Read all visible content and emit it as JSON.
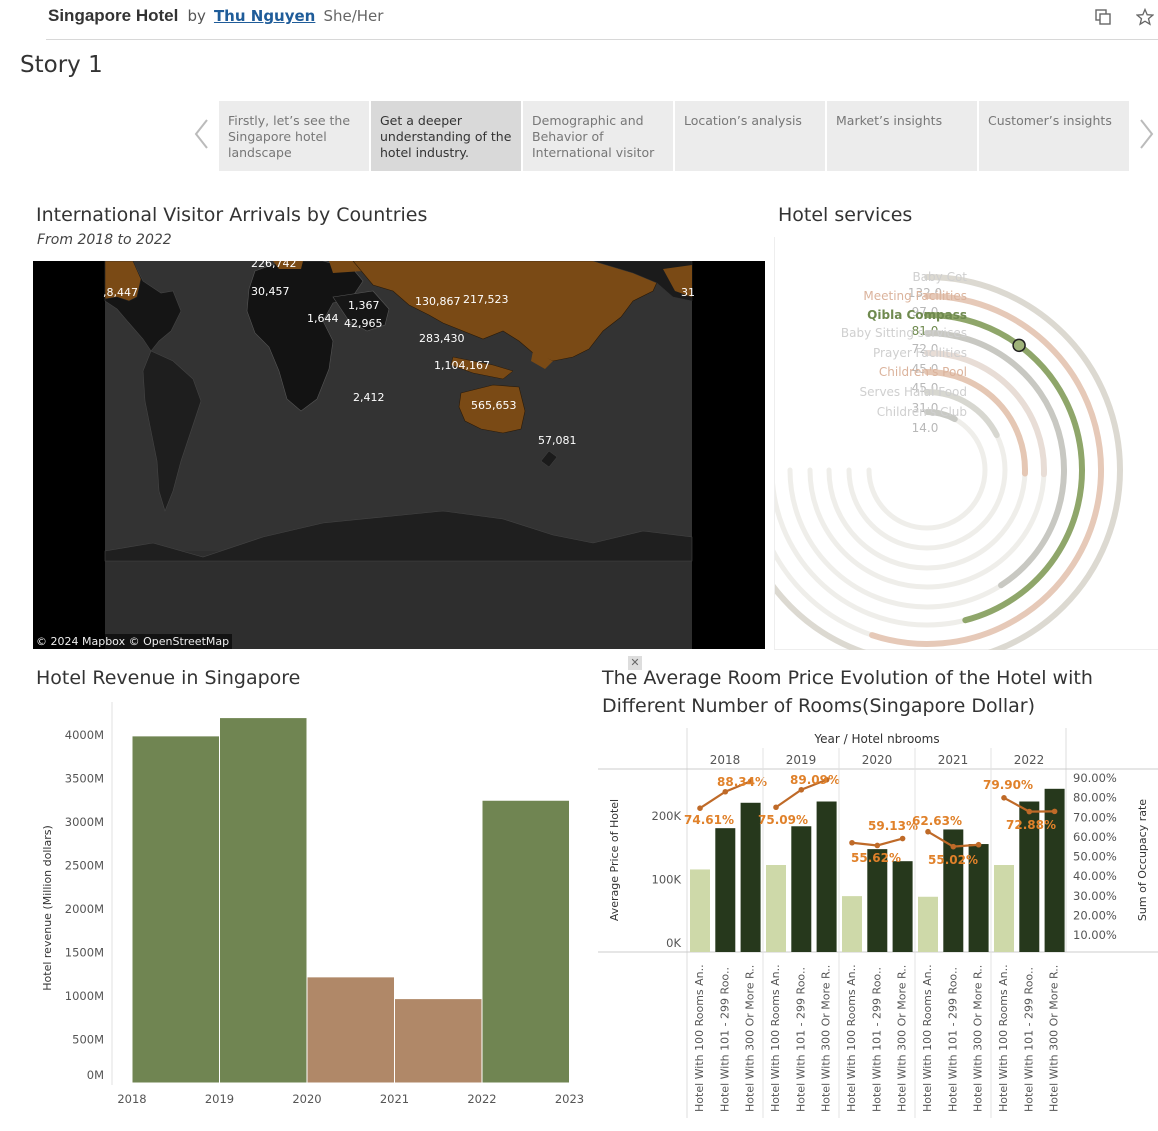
{
  "header": {
    "workbook_title": "Singapore Hotel",
    "by": "by",
    "author": "Thu Nguyen",
    "pronouns": "She/Her"
  },
  "story_title": "Story 1",
  "story_tabs": [
    {
      "label": "Firstly, let’s see the Singapore hotel landscape",
      "active": false
    },
    {
      "label": "Get a deeper understanding of the hotel industry.",
      "active": true
    },
    {
      "label": "Demographic and Behavior of International visitor",
      "active": false
    },
    {
      "label": "Location’s analysis",
      "active": false
    },
    {
      "label": "Market’s insights",
      "active": false
    },
    {
      "label": "Customer’s insights",
      "active": false
    }
  ],
  "colors": {
    "green": "#708552",
    "brown": "#b08868",
    "dark_green": "#26381c",
    "light_green": "#ced9a9",
    "orange": "#e0812a",
    "land": "#7a4a15"
  },
  "map_panel": {
    "title": "International Visitor Arrivals by Countries",
    "subtitle": "From 2018 to 2022",
    "credit": "© 2024 Mapbox  © OpenStreetMap",
    "labels": [
      "226,742",
      ",8,447",
      "30,457",
      "1,367",
      "130,867",
      "217,523",
      "31",
      "1,644",
      "42,965",
      "283,430",
      "1,104,167",
      "2,412",
      "565,653",
      "57,081"
    ]
  },
  "services_panel": {
    "title": "Hotel services",
    "items": [
      {
        "name": "Baby Cot",
        "value": "132.0"
      },
      {
        "name": "Meeting Facilities",
        "value": "97.0"
      },
      {
        "name": "Qibla Compass",
        "value": "81.0"
      },
      {
        "name": "Baby Sitting services",
        "value": "72.0"
      },
      {
        "name": "Prayer Facilities",
        "value": "45.0"
      },
      {
        "name": "Children's Pool",
        "value": "45.0"
      },
      {
        "name": "Serves Halal Food",
        "value": "31.0"
      },
      {
        "name": "Children's Club",
        "value": "14.0"
      }
    ]
  },
  "revenue_panel": {
    "title": "Hotel Revenue in Singapore"
  },
  "price_panel": {
    "title_line1": "The Average Room Price Evolution of the Hotel with",
    "title_line2": "Different Number of Rooms(Singapore Dollar)"
  },
  "chart_data": [
    {
      "type": "bar",
      "title": "Hotel Revenue in Singapore",
      "ylabel": "Hotel revenue (Million dollars)",
      "xlabel": "",
      "x_ticks": [
        "2018",
        "2019",
        "2020",
        "2021",
        "2022",
        "2023"
      ],
      "categories": [
        "2018",
        "2019",
        "2020",
        "2021",
        "2022"
      ],
      "values": [
        3990,
        4200,
        1220,
        970,
        3250
      ],
      "bar_colors": [
        "#708552",
        "#708552",
        "#b08868",
        "#b08868",
        "#708552"
      ],
      "y_ticks": [
        "0M",
        "500M",
        "1000M",
        "1500M",
        "2000M",
        "2500M",
        "3000M",
        "3500M",
        "4000M"
      ],
      "ylim": [
        0,
        4200
      ]
    },
    {
      "type": "bar",
      "title": "Year / Hotel nbrooms",
      "years": [
        "2018",
        "2019",
        "2020",
        "2021",
        "2022"
      ],
      "categories": [
        "Hotel With 100 Rooms An..",
        "Hotel With 101 - 299 Roo..",
        "Hotel With 300 Or More R.."
      ],
      "ylabel": "Average Price of Hotel",
      "y2label": "Sum of Occupacy rate",
      "y_ticks": [
        "0K",
        "100K",
        "200K"
      ],
      "y2_ticks": [
        "10.00%",
        "20.00%",
        "30.00%",
        "40.00%",
        "50.00%",
        "60.00%",
        "70.00%",
        "80.00%",
        "90.00%"
      ],
      "ylim": [
        0,
        260000
      ],
      "y2lim": [
        0,
        95
      ],
      "series": [
        {
          "name": "Average Price of Hotel",
          "values": [
            [
              130000,
              195000,
              235000
            ],
            [
              137000,
              198000,
              237000
            ],
            [
              88000,
              162000,
              143000
            ],
            [
              87000,
              193000,
              170000
            ],
            [
              137000,
              237000,
              257000
            ]
          ]
        },
        {
          "name": "Sum of Occupacy rate",
          "values": [
            [
              74.61,
              83,
              88.34
            ],
            [
              75.09,
              84,
              89.09
            ],
            [
              57,
              55.62,
              59.13
            ],
            [
              62.63,
              55.02,
              56
            ],
            [
              79.9,
              72.88,
              73
            ]
          ]
        }
      ],
      "point_labels": [
        [
          "74.61%",
          "88.34%"
        ],
        [
          "75.09%",
          "89.09%"
        ],
        [
          "55.62%",
          "59.13%"
        ],
        [
          "62.63%",
          "55.02%"
        ],
        [
          "79.90%",
          "72.88%"
        ]
      ],
      "bar_colors": [
        "#ced9a9",
        "#26381c",
        "#26381c"
      ],
      "line_color": "#bf6a28"
    }
  ]
}
